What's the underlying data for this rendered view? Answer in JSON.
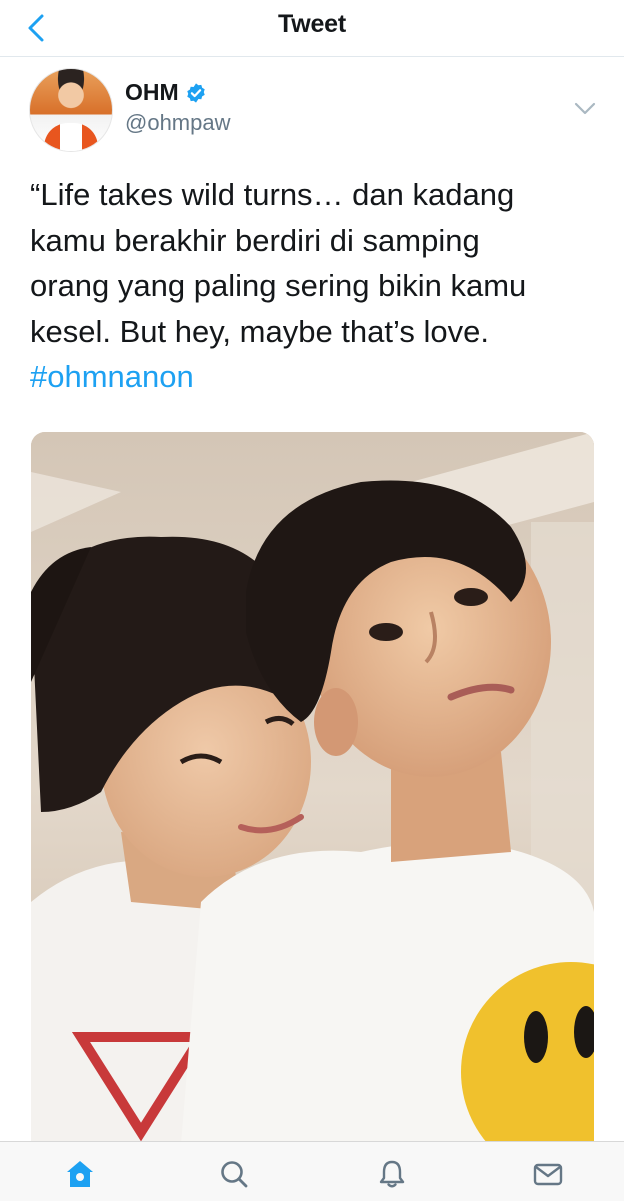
{
  "header": {
    "title": "Tweet",
    "back_icon": "chevron-left-icon"
  },
  "author": {
    "display_name": "OHM",
    "handle": "@ohmpaw",
    "verified": true,
    "avatar_icon": "avatar"
  },
  "tweet": {
    "lines": [
      "“Life takes wild turns… dan kadang",
      "kamu berakhir berdiri di samping",
      "orang yang paling sering bikin kamu",
      "kesel. But hey, maybe that’s love."
    ],
    "hashtag": "#ohmnanon"
  },
  "tabbar": {
    "items": [
      {
        "icon": "home-icon",
        "active": true
      },
      {
        "icon": "search-icon",
        "active": false
      },
      {
        "icon": "bell-icon",
        "active": false
      },
      {
        "icon": "mail-icon",
        "active": false
      }
    ]
  },
  "colors": {
    "accent": "#1da1f2",
    "text": "#14171a",
    "secondary": "#657786"
  }
}
